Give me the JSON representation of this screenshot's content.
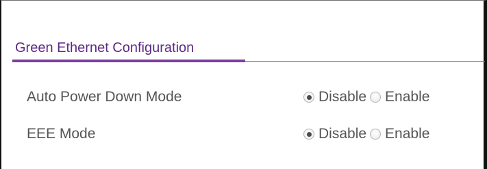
{
  "section": {
    "title": "Green Ethernet Configuration"
  },
  "rows": [
    {
      "label": "Auto Power Down Mode",
      "options": [
        "Disable",
        "Enable"
      ],
      "selected": "Disable"
    },
    {
      "label": "EEE Mode",
      "options": [
        "Disable",
        "Enable"
      ],
      "selected": "Disable"
    }
  ],
  "colors": {
    "accent": "#7b3fa2",
    "title_text": "#5e2a84",
    "label_text": "#555555"
  }
}
